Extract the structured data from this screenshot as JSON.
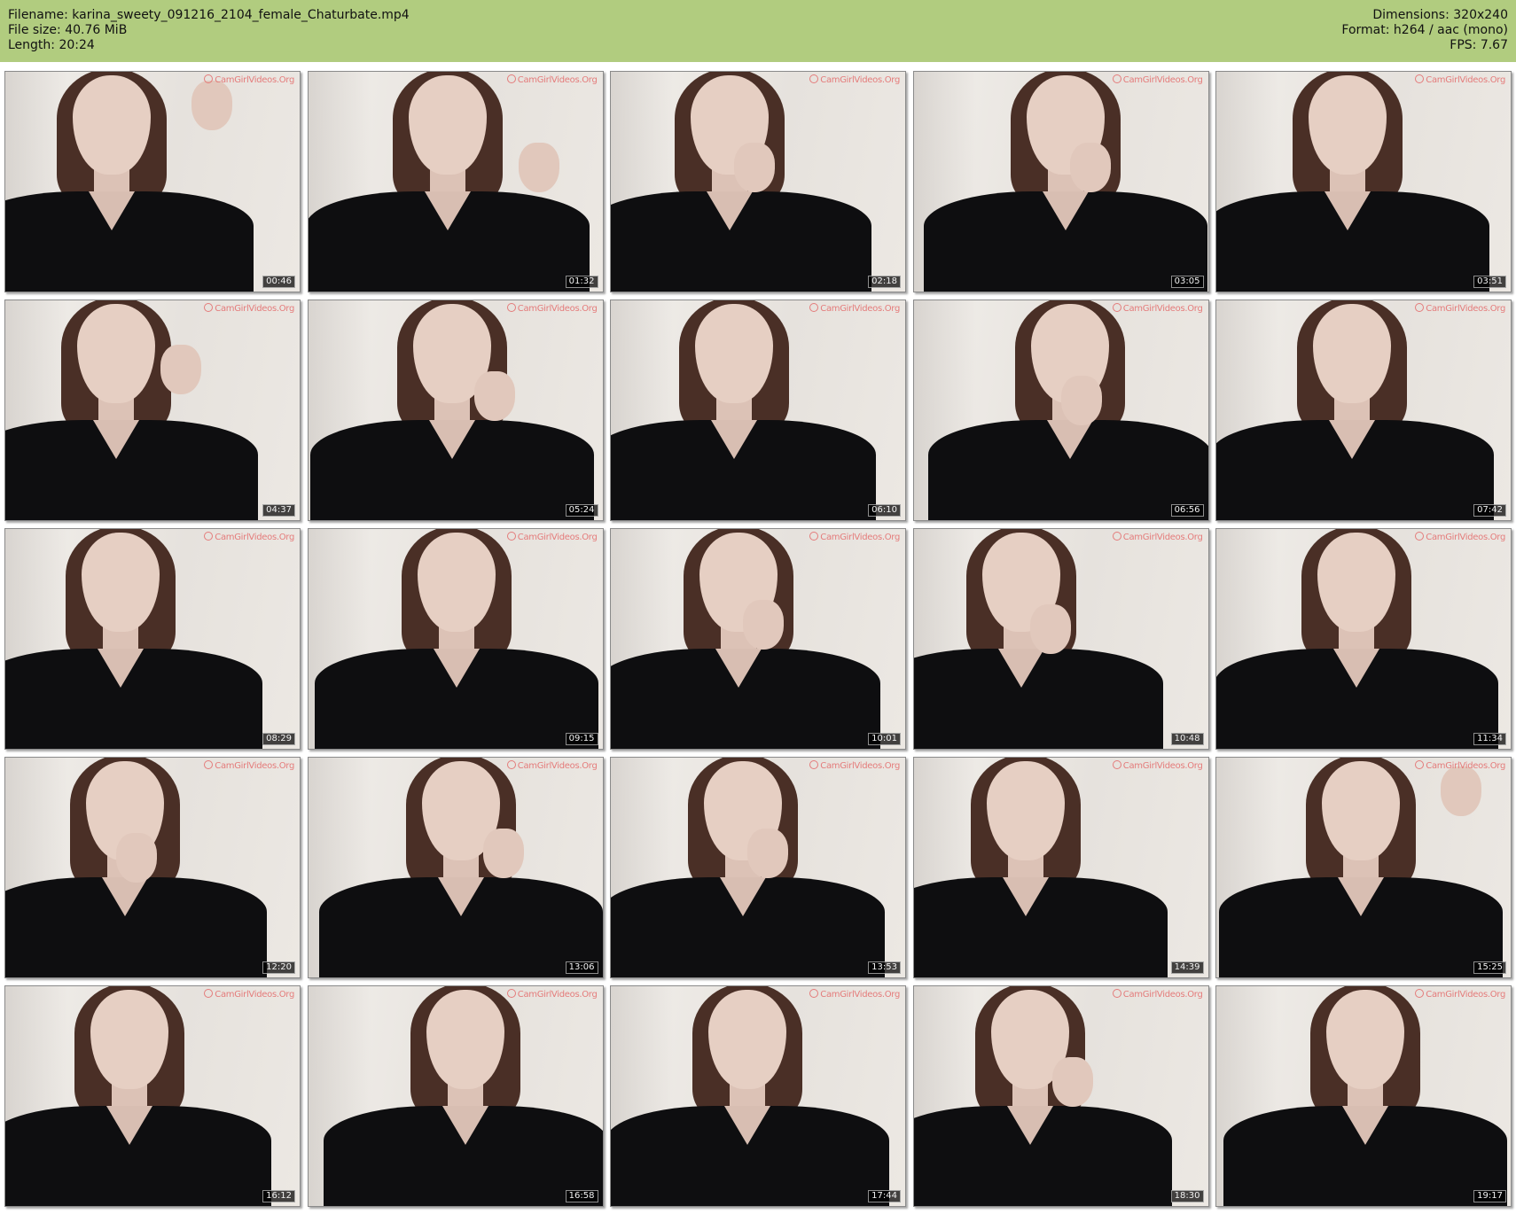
{
  "meta": {
    "filename_line": "Filename: karina_sweety_091216_2104_female_Chaturbate.mp4",
    "filesize_line": "File size: 40.76 MiB",
    "length_line": "Length: 20:24",
    "dimensions_line": "Dimensions: 320x240",
    "format_line": "Format: h264 / aac (mono)",
    "fps_line": "FPS: 7.67"
  },
  "colors": {
    "header_bg": "#b1cc7f",
    "timestamp_bg": "#000000",
    "watermark": "#e46a6a"
  },
  "watermark_text": "CamGirlVideos.Org",
  "thumbnails": [
    {
      "time": "00:46",
      "hand": "hair-right"
    },
    {
      "time": "01:32",
      "hand": "right-shoulder"
    },
    {
      "time": "02:18",
      "hand": "chin"
    },
    {
      "time": "03:05",
      "hand": "chin-laugh"
    },
    {
      "time": "03:51",
      "hand": "none"
    },
    {
      "time": "04:37",
      "hand": "cheek-right"
    },
    {
      "time": "05:24",
      "hand": "chin-right"
    },
    {
      "time": "06:10",
      "hand": "none"
    },
    {
      "time": "06:56",
      "hand": "mouth"
    },
    {
      "time": "07:42",
      "hand": "none"
    },
    {
      "time": "08:29",
      "hand": "none"
    },
    {
      "time": "09:15",
      "hand": "none"
    },
    {
      "time": "10:01",
      "hand": "chin"
    },
    {
      "time": "10:48",
      "hand": "mouth-right"
    },
    {
      "time": "11:34",
      "hand": "none"
    },
    {
      "time": "12:20",
      "hand": "mouth"
    },
    {
      "time": "13:06",
      "hand": "chin-right"
    },
    {
      "time": "13:53",
      "hand": "chin"
    },
    {
      "time": "14:39",
      "hand": "none"
    },
    {
      "time": "15:25",
      "hand": "hair-right"
    },
    {
      "time": "16:12",
      "hand": "none"
    },
    {
      "time": "16:58",
      "hand": "none"
    },
    {
      "time": "17:44",
      "hand": "none"
    },
    {
      "time": "18:30",
      "hand": "chin-right"
    },
    {
      "time": "19:17",
      "hand": "none"
    }
  ]
}
